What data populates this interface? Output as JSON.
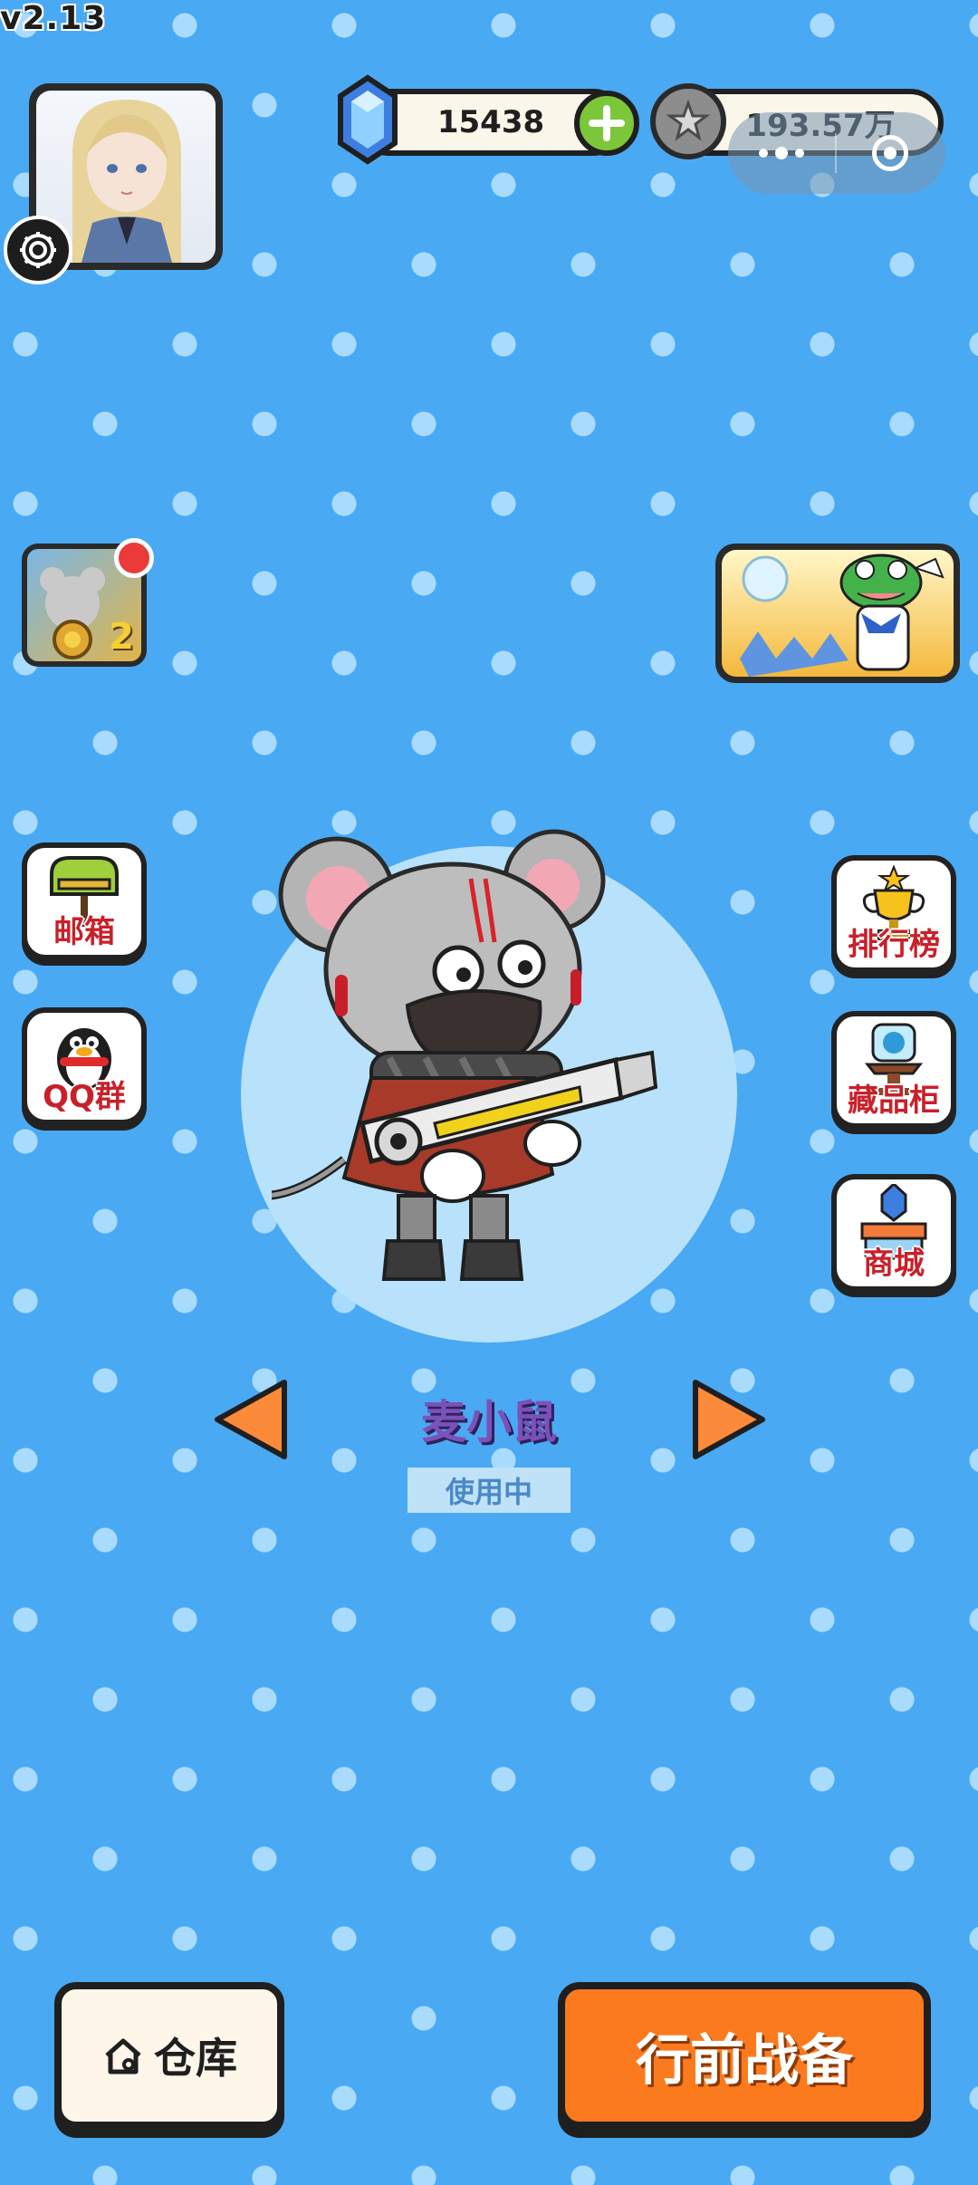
{
  "version": "v2.13",
  "currency": {
    "gems": "15438",
    "coins": "193.57万"
  },
  "side_menu": {
    "left": [
      {
        "label": "邮箱"
      },
      {
        "label": "QQ群"
      }
    ],
    "right": [
      {
        "label": "排行榜"
      },
      {
        "label": "藏品柜"
      },
      {
        "label": "商城"
      }
    ]
  },
  "event_left": {
    "number": "2"
  },
  "character": {
    "name": "麦小鼠",
    "status": "使用中"
  },
  "bottom": {
    "warehouse_label": "仓库",
    "start_label": "行前战备"
  },
  "colors": {
    "background": "#4aa9f3",
    "accent_orange": "#fb7a1e",
    "plus_green": "#7cc63a",
    "label_red": "#c8202a",
    "name_purple": "#7b52b8"
  }
}
